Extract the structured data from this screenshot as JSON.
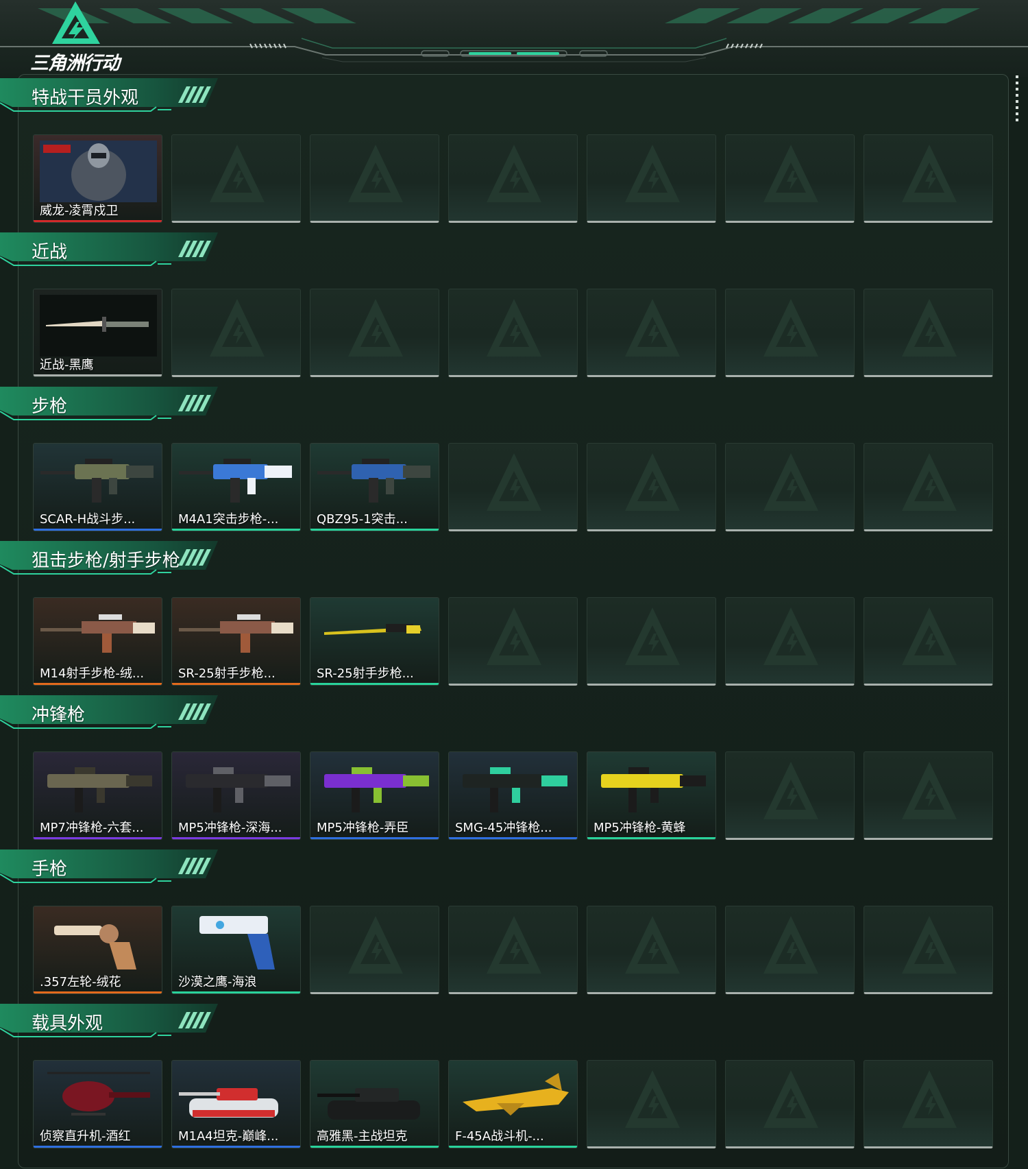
{
  "app": {
    "logo_text": "三角洲行动"
  },
  "colors": {
    "accent": "#1fd39a",
    "rarity_red": "#d22a2a",
    "rarity_gray": "#aab1ad",
    "rarity_blue": "#2f6fe0",
    "rarity_green": "#29d39b",
    "rarity_orange": "#e26a1c",
    "rarity_purple": "#7a3be0"
  },
  "sections": [
    {
      "title": "特战干员外观",
      "items": [
        {
          "label": "威龙-凌霄戍卫",
          "rarity": "red",
          "icon": "operator-portrait",
          "bg": "#3a2a2a"
        }
      ]
    },
    {
      "title": "近战",
      "items": [
        {
          "label": "近战-黑鹰",
          "rarity": "gray",
          "icon": "knife",
          "bg": "#1d2320"
        }
      ]
    },
    {
      "title": "步枪",
      "items": [
        {
          "label": "SCAR-H战斗步...",
          "rarity": "blue",
          "icon": "rifle-camo",
          "bg": "#213437"
        },
        {
          "label": "M4A1突击步枪-...",
          "rarity": "green",
          "icon": "rifle-blue-white",
          "bg": "#1f3a33"
        },
        {
          "label": "QBZ95-1突击...",
          "rarity": "green",
          "icon": "bullpup-blue",
          "bg": "#1f3a33"
        }
      ]
    },
    {
      "title": "狙击步枪/射手步枪",
      "items": [
        {
          "label": "M14射手步枪-绒...",
          "rarity": "orange",
          "icon": "marksman-rifle",
          "bg": "#3a2b22"
        },
        {
          "label": "SR-25射手步枪...",
          "rarity": "orange",
          "icon": "marksman-rifle",
          "bg": "#3a2b22"
        },
        {
          "label": "SR-25射手步枪...",
          "rarity": "green",
          "icon": "marksman-rifle-yellow",
          "bg": "#1f3a33"
        }
      ]
    },
    {
      "title": "冲锋枪",
      "items": [
        {
          "label": "MP7冲锋枪-六套...",
          "rarity": "purple",
          "icon": "smg-camo",
          "bg": "#2a2738"
        },
        {
          "label": "MP5冲锋枪-深海...",
          "rarity": "purple",
          "icon": "smg-dark",
          "bg": "#2a2738"
        },
        {
          "label": "MP5冲锋枪-弄臣",
          "rarity": "blue",
          "icon": "smg-purple-green",
          "bg": "#22303a"
        },
        {
          "label": "SMG-45冲锋枪...",
          "rarity": "blue",
          "icon": "smg-teal",
          "bg": "#22303a"
        },
        {
          "label": "MP5冲锋枪-黄蜂",
          "rarity": "green",
          "icon": "smg-yellow",
          "bg": "#1f3a33"
        }
      ]
    },
    {
      "title": "手枪",
      "items": [
        {
          "label": ".357左轮-绒花",
          "rarity": "orange",
          "icon": "revolver",
          "bg": "#3a2b22"
        },
        {
          "label": "沙漠之鹰-海浪",
          "rarity": "green",
          "icon": "desert-eagle",
          "bg": "#1f3a33"
        }
      ]
    },
    {
      "title": "载具外观",
      "items": [
        {
          "label": "侦察直升机-酒红",
          "rarity": "blue",
          "icon": "helicopter",
          "bg": "#22303a"
        },
        {
          "label": "M1A4坦克-巅峰...",
          "rarity": "blue",
          "icon": "tank-red-white",
          "bg": "#22303a"
        },
        {
          "label": "高雅黑-主战坦克",
          "rarity": "green",
          "icon": "tank-black",
          "bg": "#1f3a33"
        },
        {
          "label": "F-45A战斗机-...",
          "rarity": "green",
          "icon": "fighter-jet",
          "bg": "#1f3a33"
        }
      ]
    }
  ]
}
